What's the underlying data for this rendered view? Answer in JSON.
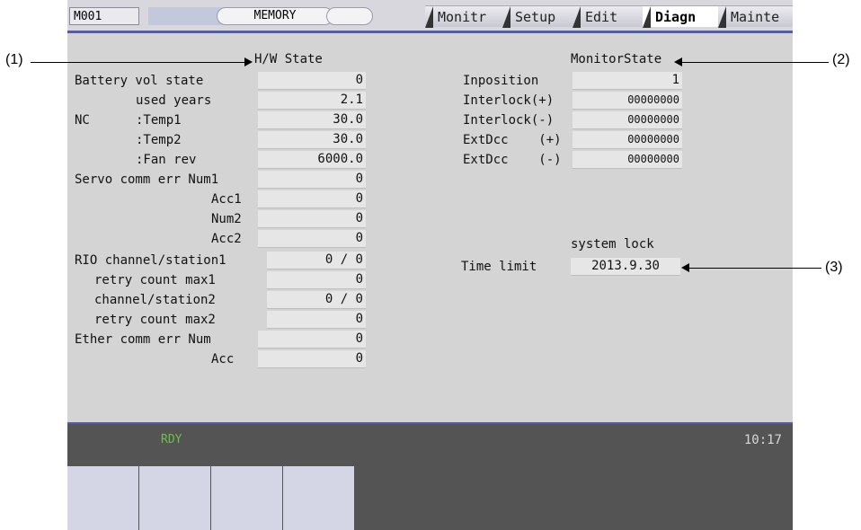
{
  "topbar": {
    "screen_id": "M001",
    "mode": "MEMORY",
    "tabs": [
      "Monitr",
      "Setup",
      "Edit",
      "Diagn",
      "Mainte"
    ],
    "active_tab": "Diagn"
  },
  "hw_state": {
    "title": "H/W State",
    "rows": [
      {
        "label": "Battery vol state",
        "value": "0"
      },
      {
        "label": "used years",
        "value": "2.1"
      },
      {
        "label": "NC",
        "value": ""
      },
      {
        "label": ":Temp1",
        "value": "30.0"
      },
      {
        "label": ":Temp2",
        "value": "30.0"
      },
      {
        "label": ":Fan rev",
        "value": "6000.0"
      },
      {
        "label": "Servo comm err Num1",
        "value": "0"
      },
      {
        "label": "Acc1",
        "value": "0"
      },
      {
        "label": "Num2",
        "value": "0"
      },
      {
        "label": "Acc2",
        "value": "0"
      },
      {
        "label": "RIO channel/station1",
        "value": "0 / 0"
      },
      {
        "label": "retry count max1",
        "value": "0"
      },
      {
        "label": "channel/station2",
        "value": "0 / 0"
      },
      {
        "label": "retry count max2",
        "value": "0"
      },
      {
        "label": "Ether comm err Num",
        "value": "0"
      },
      {
        "label": "Acc",
        "value": "0"
      }
    ]
  },
  "monitor_state": {
    "title": "MonitorState",
    "rows": [
      {
        "label": "Inposition",
        "value": "1"
      },
      {
        "label": "Interlock(+)",
        "value": "00000000"
      },
      {
        "label": "Interlock(-)",
        "value": "00000000"
      },
      {
        "label": "ExtDcc    (+)",
        "value": "00000000"
      },
      {
        "label": "ExtDcc    (-)",
        "value": "00000000"
      }
    ]
  },
  "system_lock": {
    "title": "system lock",
    "label": "Time limit",
    "value": "2013.9.30"
  },
  "status": {
    "ready": "RDY",
    "clock": "10:17"
  },
  "callouts": {
    "c1": "(1)",
    "c2": "(2)",
    "c3": "(3)"
  }
}
